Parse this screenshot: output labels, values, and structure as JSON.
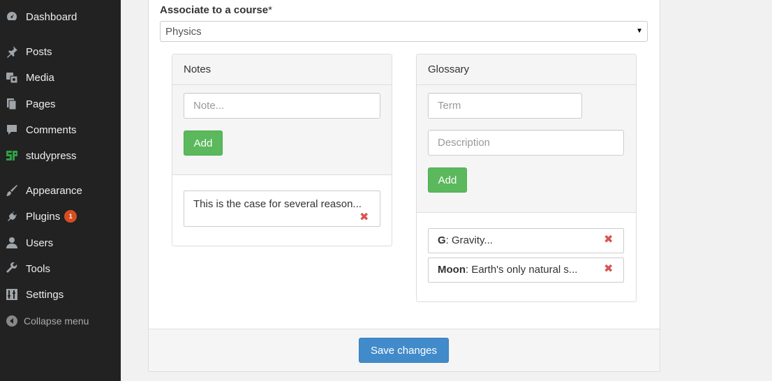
{
  "sidebar": {
    "items": [
      {
        "label": "Dashboard",
        "icon": "dashboard-icon"
      },
      {
        "label": "Posts",
        "icon": "pushpin-icon"
      },
      {
        "label": "Media",
        "icon": "media-icon"
      },
      {
        "label": "Pages",
        "icon": "pages-icon"
      },
      {
        "label": "Comments",
        "icon": "comment-icon"
      },
      {
        "label": "studypress",
        "icon": "studypress-logo-icon"
      },
      {
        "label": "Appearance",
        "icon": "paintbrush-icon"
      },
      {
        "label": "Plugins",
        "icon": "plugin-icon",
        "badge": "1"
      },
      {
        "label": "Users",
        "icon": "user-icon"
      },
      {
        "label": "Tools",
        "icon": "wrench-icon"
      },
      {
        "label": "Settings",
        "icon": "settings-icon"
      }
    ],
    "collapse_label": "Collapse menu"
  },
  "form": {
    "course_label": "Associate to a course",
    "required_mark": "*",
    "course_value": "Physics"
  },
  "notes": {
    "title": "Notes",
    "placeholder": "Note...",
    "add_label": "Add",
    "items": [
      "This is the case for several reason..."
    ]
  },
  "glossary": {
    "title": "Glossary",
    "term_placeholder": "Term",
    "description_placeholder": "Description",
    "add_label": "Add",
    "items": [
      {
        "term": "G",
        "description": ": Gravity..."
      },
      {
        "term": "Moon",
        "description": ": Earth's only natural s..."
      }
    ]
  },
  "footer": {
    "save_label": "Save changes"
  },
  "colors": {
    "sidebar_bg": "#222222",
    "add_button": "#5cb85c",
    "save_button": "#428bca",
    "delete_icon": "#d9534f",
    "badge": "#d54e21"
  }
}
